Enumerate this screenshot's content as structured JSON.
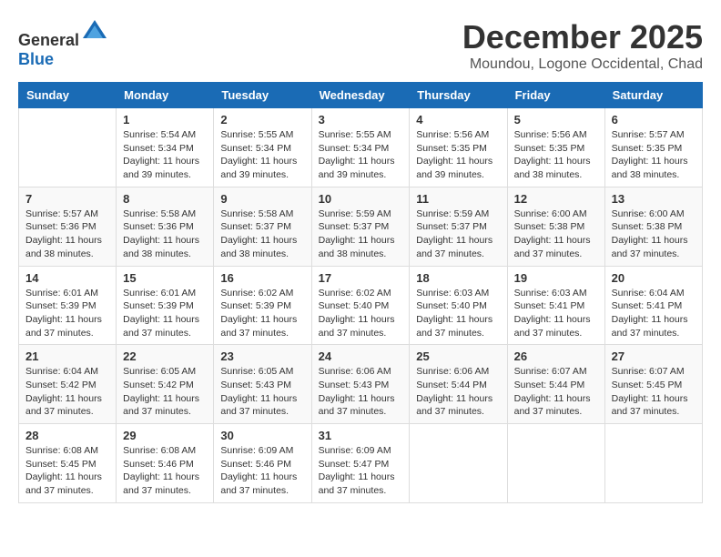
{
  "logo": {
    "general": "General",
    "blue": "Blue"
  },
  "title": {
    "month": "December 2025",
    "location": "Moundou, Logone Occidental, Chad"
  },
  "days_of_week": [
    "Sunday",
    "Monday",
    "Tuesday",
    "Wednesday",
    "Thursday",
    "Friday",
    "Saturday"
  ],
  "weeks": [
    [
      {
        "day": "",
        "info": ""
      },
      {
        "day": "1",
        "info": "Sunrise: 5:54 AM\nSunset: 5:34 PM\nDaylight: 11 hours\nand 39 minutes."
      },
      {
        "day": "2",
        "info": "Sunrise: 5:55 AM\nSunset: 5:34 PM\nDaylight: 11 hours\nand 39 minutes."
      },
      {
        "day": "3",
        "info": "Sunrise: 5:55 AM\nSunset: 5:34 PM\nDaylight: 11 hours\nand 39 minutes."
      },
      {
        "day": "4",
        "info": "Sunrise: 5:56 AM\nSunset: 5:35 PM\nDaylight: 11 hours\nand 39 minutes."
      },
      {
        "day": "5",
        "info": "Sunrise: 5:56 AM\nSunset: 5:35 PM\nDaylight: 11 hours\nand 38 minutes."
      },
      {
        "day": "6",
        "info": "Sunrise: 5:57 AM\nSunset: 5:35 PM\nDaylight: 11 hours\nand 38 minutes."
      }
    ],
    [
      {
        "day": "7",
        "info": "Sunrise: 5:57 AM\nSunset: 5:36 PM\nDaylight: 11 hours\nand 38 minutes."
      },
      {
        "day": "8",
        "info": "Sunrise: 5:58 AM\nSunset: 5:36 PM\nDaylight: 11 hours\nand 38 minutes."
      },
      {
        "day": "9",
        "info": "Sunrise: 5:58 AM\nSunset: 5:37 PM\nDaylight: 11 hours\nand 38 minutes."
      },
      {
        "day": "10",
        "info": "Sunrise: 5:59 AM\nSunset: 5:37 PM\nDaylight: 11 hours\nand 38 minutes."
      },
      {
        "day": "11",
        "info": "Sunrise: 5:59 AM\nSunset: 5:37 PM\nDaylight: 11 hours\nand 37 minutes."
      },
      {
        "day": "12",
        "info": "Sunrise: 6:00 AM\nSunset: 5:38 PM\nDaylight: 11 hours\nand 37 minutes."
      },
      {
        "day": "13",
        "info": "Sunrise: 6:00 AM\nSunset: 5:38 PM\nDaylight: 11 hours\nand 37 minutes."
      }
    ],
    [
      {
        "day": "14",
        "info": "Sunrise: 6:01 AM\nSunset: 5:39 PM\nDaylight: 11 hours\nand 37 minutes."
      },
      {
        "day": "15",
        "info": "Sunrise: 6:01 AM\nSunset: 5:39 PM\nDaylight: 11 hours\nand 37 minutes."
      },
      {
        "day": "16",
        "info": "Sunrise: 6:02 AM\nSunset: 5:39 PM\nDaylight: 11 hours\nand 37 minutes."
      },
      {
        "day": "17",
        "info": "Sunrise: 6:02 AM\nSunset: 5:40 PM\nDaylight: 11 hours\nand 37 minutes."
      },
      {
        "day": "18",
        "info": "Sunrise: 6:03 AM\nSunset: 5:40 PM\nDaylight: 11 hours\nand 37 minutes."
      },
      {
        "day": "19",
        "info": "Sunrise: 6:03 AM\nSunset: 5:41 PM\nDaylight: 11 hours\nand 37 minutes."
      },
      {
        "day": "20",
        "info": "Sunrise: 6:04 AM\nSunset: 5:41 PM\nDaylight: 11 hours\nand 37 minutes."
      }
    ],
    [
      {
        "day": "21",
        "info": "Sunrise: 6:04 AM\nSunset: 5:42 PM\nDaylight: 11 hours\nand 37 minutes."
      },
      {
        "day": "22",
        "info": "Sunrise: 6:05 AM\nSunset: 5:42 PM\nDaylight: 11 hours\nand 37 minutes."
      },
      {
        "day": "23",
        "info": "Sunrise: 6:05 AM\nSunset: 5:43 PM\nDaylight: 11 hours\nand 37 minutes."
      },
      {
        "day": "24",
        "info": "Sunrise: 6:06 AM\nSunset: 5:43 PM\nDaylight: 11 hours\nand 37 minutes."
      },
      {
        "day": "25",
        "info": "Sunrise: 6:06 AM\nSunset: 5:44 PM\nDaylight: 11 hours\nand 37 minutes."
      },
      {
        "day": "26",
        "info": "Sunrise: 6:07 AM\nSunset: 5:44 PM\nDaylight: 11 hours\nand 37 minutes."
      },
      {
        "day": "27",
        "info": "Sunrise: 6:07 AM\nSunset: 5:45 PM\nDaylight: 11 hours\nand 37 minutes."
      }
    ],
    [
      {
        "day": "28",
        "info": "Sunrise: 6:08 AM\nSunset: 5:45 PM\nDaylight: 11 hours\nand 37 minutes."
      },
      {
        "day": "29",
        "info": "Sunrise: 6:08 AM\nSunset: 5:46 PM\nDaylight: 11 hours\nand 37 minutes."
      },
      {
        "day": "30",
        "info": "Sunrise: 6:09 AM\nSunset: 5:46 PM\nDaylight: 11 hours\nand 37 minutes."
      },
      {
        "day": "31",
        "info": "Sunrise: 6:09 AM\nSunset: 5:47 PM\nDaylight: 11 hours\nand 37 minutes."
      },
      {
        "day": "",
        "info": ""
      },
      {
        "day": "",
        "info": ""
      },
      {
        "day": "",
        "info": ""
      }
    ]
  ]
}
